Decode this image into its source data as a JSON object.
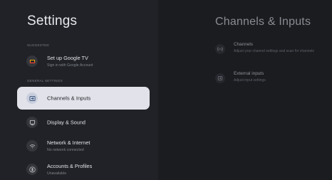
{
  "left": {
    "title": "Settings",
    "sections": {
      "suggested": "SUGGESTED",
      "general": "GENERAL SETTINGS"
    },
    "items": [
      {
        "title": "Set up Google TV",
        "subtitle": "Sign in with Google Account"
      },
      {
        "title": "Channels & Inputs",
        "subtitle": ""
      },
      {
        "title": "Display & Sound",
        "subtitle": ""
      },
      {
        "title": "Network & Internet",
        "subtitle": "No network connected"
      },
      {
        "title": "Accounts & Profiles",
        "subtitle": "Unavailable"
      }
    ]
  },
  "right": {
    "title": "Channels & Inputs",
    "items": [
      {
        "title": "Channels",
        "description": "Adjust your channel settings and scan for channels"
      },
      {
        "title": "External inputs",
        "description": "Adjust input settings"
      }
    ]
  },
  "colors": {
    "background": "#1b1d22",
    "focus_card": "#e2e3ea",
    "google_tv_yellow": "#fbbc04",
    "google_tv_red": "#ea4335"
  },
  "icons": [
    "google-tv-icon",
    "input-icon",
    "display-icon",
    "wifi-icon",
    "account-icon",
    "antenna-icon",
    "external-input-icon"
  ]
}
